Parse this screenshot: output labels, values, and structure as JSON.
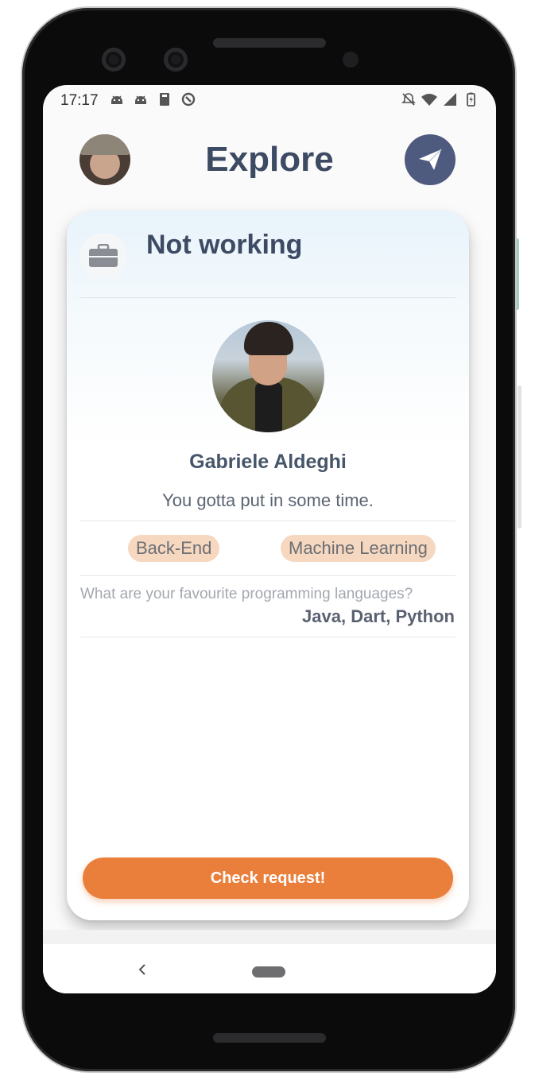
{
  "status_bar": {
    "time": "17:17",
    "left_icons": [
      "android-icon",
      "android-icon",
      "book-icon",
      "sync-icon"
    ],
    "right_icons": [
      "notifications-off-icon",
      "wifi-icon",
      "signal-icon",
      "battery-icon"
    ]
  },
  "header": {
    "title": "Explore",
    "avatar_icon": "user-avatar",
    "action_icon": "send-icon"
  },
  "card": {
    "status_icon": "briefcase-icon",
    "work_status": "Not working",
    "name": "Gabriele Aldeghi",
    "bio": "You gotta put in some time.",
    "tags": [
      "Back-End",
      "Machine Learning"
    ],
    "question": "What are your favourite programming languages?",
    "answer": "Java, Dart, Python",
    "cta_label": "Check request!"
  },
  "nav_bar": {
    "back_icon": "chevron-left-icon",
    "home_icon": "home-pill-icon"
  },
  "colors": {
    "title": "#3d4a63",
    "accent": "#ea7f3c",
    "tag_bg": "#f6d7bf",
    "send_button": "#4e5a7e"
  }
}
